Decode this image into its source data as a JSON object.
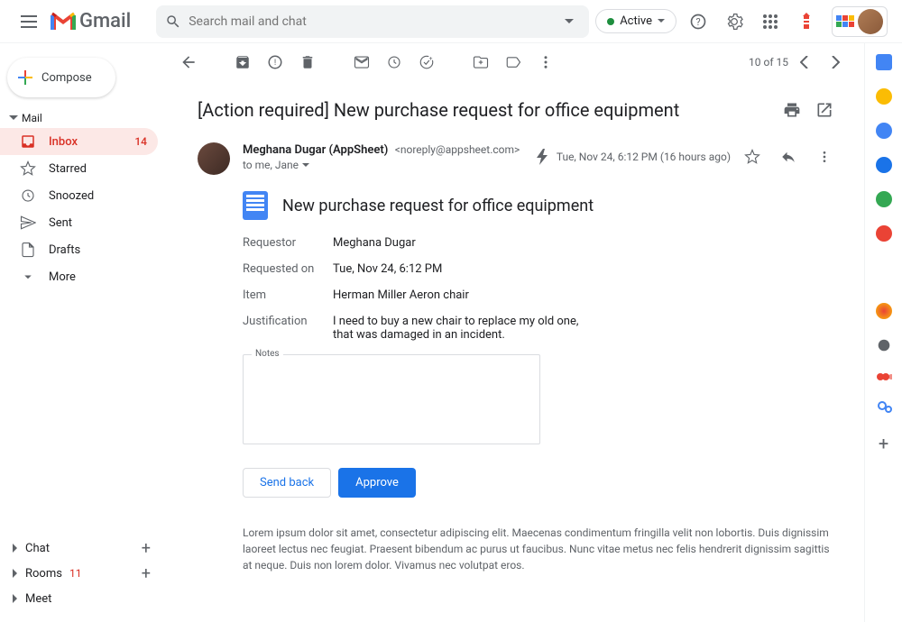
{
  "header": {
    "logo_text": "Gmail",
    "search_placeholder": "Search mail and chat",
    "active_label": "Active"
  },
  "sidebar": {
    "compose_label": "Compose",
    "mail_section": "Mail",
    "items": [
      {
        "label": "Inbox",
        "count": "14"
      },
      {
        "label": "Starred"
      },
      {
        "label": "Snoozed"
      },
      {
        "label": "Sent"
      },
      {
        "label": "Drafts"
      },
      {
        "label": "More"
      }
    ],
    "bottom": {
      "chat": "Chat",
      "rooms": "Rooms",
      "rooms_badge": "11",
      "meet": "Meet"
    }
  },
  "toolbar": {
    "pager": "10 of 15"
  },
  "message": {
    "subject": "[Action required] New purchase request for office equipment",
    "sender_name": "Meghana Dugar (AppSheet)",
    "sender_email": "<noreply@appsheet.com>",
    "recipients": "to me, Jane",
    "timestamp": "Tue, Nov 24, 6:12 PM (16 hours ago)"
  },
  "card": {
    "title": "New purchase request for office equipment",
    "fields": {
      "requestor_label": "Requestor",
      "requestor_value": "Meghana Dugar",
      "requested_on_label": "Requested on",
      "requested_on_value": "Tue, Nov 24, 6:12 PM",
      "item_label": "Item",
      "item_value": "Herman Miller Aeron chair",
      "justification_label": "Justification",
      "justification_value": "I need to buy a new chair to replace my old one, that was damaged in an incident."
    },
    "notes_label": "Notes",
    "send_back_label": "Send back",
    "approve_label": "Approve",
    "lorem": "Lorem ipsum dolor sit amet, consectetur adipiscing elit. Maecenas condimentum fringilla velit non lobortis. Duis dignissim laoreet lectus nec feugiat. Praesent bibendum ac purus ut faucibus. Nunc vitae metus nec felis hendrerit dignissim sagittis at neque. Duis non lorem dolor. Vivamus nec volutpat eros."
  }
}
